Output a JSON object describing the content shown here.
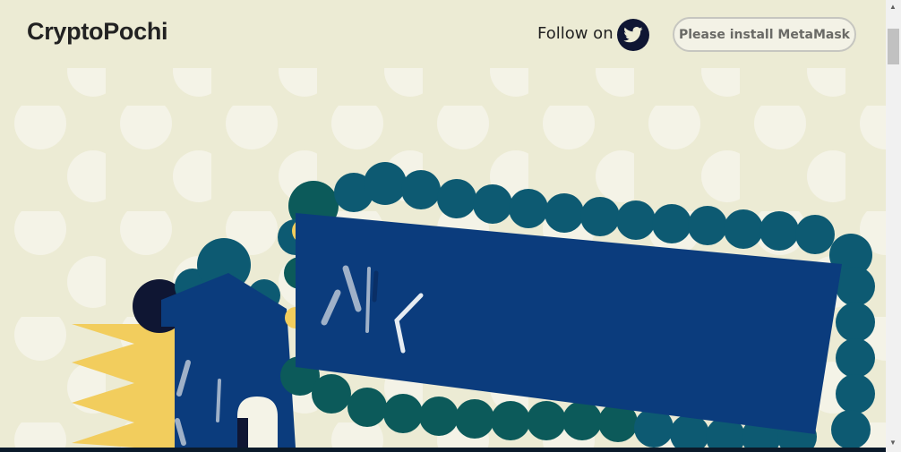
{
  "header": {
    "logo": "CryptoPochi",
    "follow_label": "Follow on",
    "twitter_icon": "twitter-bird-icon",
    "metamask_button": "Please install MetaMask"
  },
  "colors": {
    "background": "#ecebd4",
    "dots": "#f4f3e7",
    "body_blue": "#0b3c7d",
    "scallop_teal": "#0d5a72",
    "scallop_green": "#0c5a5a",
    "yellow": "#f2cd5d",
    "dark_navy": "#0f1633"
  }
}
